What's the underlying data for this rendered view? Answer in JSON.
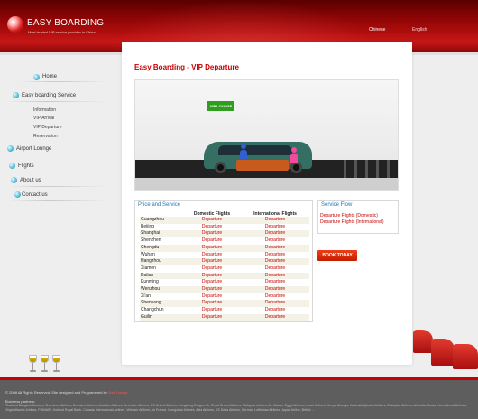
{
  "header": {
    "logo_text": "EASY BOARDING",
    "logo_sub": "Most trusted VIP service provider in China",
    "lang_cn": "Chinese",
    "lang_en": "English"
  },
  "nav": {
    "home": "Home",
    "easy_boarding": "Easy boarding Service",
    "sub": [
      "Information",
      "VIP Arrival",
      "VIP Departure",
      "Reservation"
    ],
    "airport_lounge": "Airport Lounge",
    "flights": "Flights",
    "about": "About us",
    "contact": "Contact us"
  },
  "main": {
    "title": "Easy Boarding - VIP Departure",
    "lounge_sign": "VIP LOUNGE",
    "price_title": "Price and Service",
    "col_domestic": "Domestic Flights",
    "col_international": "International Flights",
    "rows": [
      {
        "city": "Guangzhou",
        "domestic": "Departure",
        "international": "Departure"
      },
      {
        "city": "Beijing",
        "domestic": "Departure",
        "international": "Departure"
      },
      {
        "city": "Shanghai",
        "domestic": "Departure",
        "international": "Departure"
      },
      {
        "city": "Shenzhen",
        "domestic": "Departure",
        "international": "Departure"
      },
      {
        "city": "Chengdu",
        "domestic": "Departure",
        "international": "Departure"
      },
      {
        "city": "Wuhan",
        "domestic": "Departure",
        "international": "Departure"
      },
      {
        "city": "Hangzhou",
        "domestic": "Departure",
        "international": "Departure"
      },
      {
        "city": "Xiamen",
        "domestic": "Departure",
        "international": "Departure"
      },
      {
        "city": "Dalian",
        "domestic": "Departure",
        "international": "Departure"
      },
      {
        "city": "Kunming",
        "domestic": "Departure",
        "international": "Departure"
      },
      {
        "city": "Wenzhou",
        "domestic": "Departure",
        "international": "Departure"
      },
      {
        "city": "Xi'an",
        "domestic": "Departure",
        "international": "Departure"
      },
      {
        "city": "Shenyang",
        "domestic": "Departure",
        "international": "Departure"
      },
      {
        "city": "Changchun",
        "domestic": "Departure",
        "international": "Departure"
      },
      {
        "city": "Guilin",
        "domestic": "Departure",
        "international": "Departure"
      }
    ],
    "service_title": "Service Flow",
    "service_links": [
      "Departure Flights (Domestic)",
      "Departure Flights (International)"
    ],
    "book_button": "BOOK TODAY"
  },
  "footer": {
    "copyright": "© 2008 All Rights Reserved. Site designed and Programmed by",
    "designer": "Web Design",
    "partners_title": "Business partners:",
    "partners": "Thailand Bangkok Airways, Shenzhen Airlines, Emirates Airlines, Austrian Airlines, American Airlines, US United Airlines, Hongkong Dragon Air, Royal Brunei Airlines, Malaysia airlines, Air Macau, Egypt Airlines, Israel Airlines, Kenya Airways, Australia Qantas Airlines, Ethiopian Airlines, Air India, Swiss International Airlines, Virgin Atlantic Airlines, FINNAIR, Holland Royal Bank, Canada International Airlines, Vietnam Airlines, Air France, Mongolian Airlines, Asia Airlines, US Delta Airlines, German Lufthansa Airlines, Japan Airline, British ..."
  },
  "colors": {
    "brand_red": "#c40000",
    "link_blue": "#1f77b4",
    "lounge_green": "#2f9e1f"
  }
}
